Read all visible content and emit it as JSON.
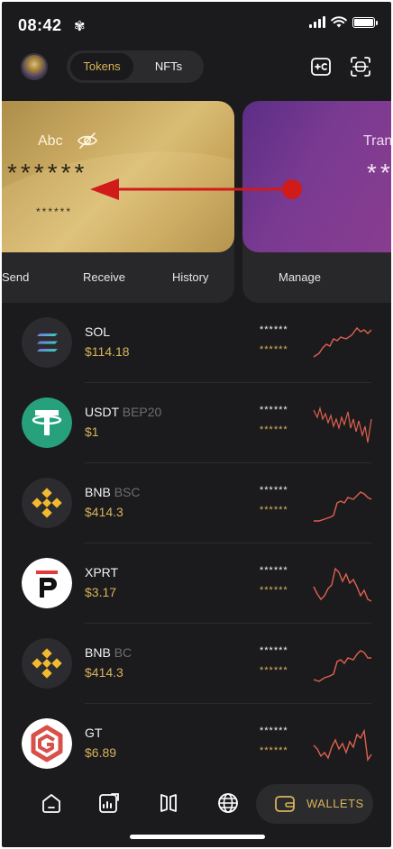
{
  "status_bar": {
    "time": "08:42",
    "flower_glyph": "✾"
  },
  "header": {
    "tabs": [
      {
        "label": "Tokens",
        "active": true
      },
      {
        "label": "NFTs",
        "active": false
      }
    ],
    "icons": [
      "avatar",
      "add-token-icon",
      "scan-icon"
    ]
  },
  "cards": [
    {
      "name": "Abc",
      "balance": "******",
      "sub_balance": "******",
      "actions": [
        "Send",
        "Receive",
        "History"
      ]
    },
    {
      "name": "Tran",
      "balance": "**",
      "actions": [
        "Manage"
      ]
    }
  ],
  "annotation": {
    "type": "swipe-left-arrow",
    "color": "#d11a1a"
  },
  "tokens": [
    {
      "symbol": "SOL",
      "network": "",
      "price": "$114.18",
      "amount": "******",
      "value": "******",
      "logo": "solana-icon"
    },
    {
      "symbol": "USDT",
      "network": "BEP20",
      "price": "$1",
      "amount": "******",
      "value": "******",
      "logo": "tether-icon"
    },
    {
      "symbol": "BNB",
      "network": "BSC",
      "price": "$414.3",
      "amount": "******",
      "value": "******",
      "logo": "bnb-icon"
    },
    {
      "symbol": "XPRT",
      "network": "",
      "price": "$3.17",
      "amount": "******",
      "value": "******",
      "logo": "persistence-icon"
    },
    {
      "symbol": "BNB",
      "network": "BC",
      "price": "$414.3",
      "amount": "******",
      "value": "******",
      "logo": "bnb-icon"
    },
    {
      "symbol": "GT",
      "network": "",
      "price": "$6.89",
      "amount": "******",
      "value": "******",
      "logo": "gatetoken-icon"
    }
  ],
  "bottom_nav": {
    "items": [
      "home-icon",
      "chart-icon",
      "apps-icon",
      "browser-icon"
    ],
    "active_label": "WALLETS"
  },
  "colors": {
    "accent_gold": "#d8b35a",
    "background": "#1b1b1d",
    "sparkline": "#e0604f"
  }
}
